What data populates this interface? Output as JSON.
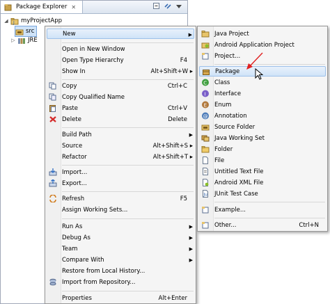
{
  "view": {
    "title": "Package Explorer",
    "close": "✕",
    "tree": [
      {
        "label": "myProjectApp"
      },
      {
        "label": "src"
      },
      {
        "label": "JRE"
      }
    ]
  },
  "context_menu": {
    "items": [
      {
        "label": "New",
        "accel": "",
        "submenu": true
      },
      {
        "label": "Open in New Window",
        "accel": ""
      },
      {
        "label": "Open Type Hierarchy",
        "accel": "F4"
      },
      {
        "label": "Show In",
        "accel": "Alt+Shift+W ▸"
      },
      {
        "label": "Copy",
        "accel": "Ctrl+C"
      },
      {
        "label": "Copy Qualified Name",
        "accel": ""
      },
      {
        "label": "Paste",
        "accel": "Ctrl+V"
      },
      {
        "label": "Delete",
        "accel": "Delete"
      },
      {
        "label": "Build Path",
        "accel": "",
        "submenu": true
      },
      {
        "label": "Source",
        "accel": "Alt+Shift+S ▸"
      },
      {
        "label": "Refactor",
        "accel": "Alt+Shift+T ▸"
      },
      {
        "label": "Import...",
        "accel": ""
      },
      {
        "label": "Export...",
        "accel": ""
      },
      {
        "label": "Refresh",
        "accel": "F5"
      },
      {
        "label": "Assign Working Sets...",
        "accel": ""
      },
      {
        "label": "Run As",
        "accel": "",
        "submenu": true
      },
      {
        "label": "Debug As",
        "accel": "",
        "submenu": true
      },
      {
        "label": "Team",
        "accel": "",
        "submenu": true
      },
      {
        "label": "Compare With",
        "accel": "",
        "submenu": true
      },
      {
        "label": "Restore from Local History...",
        "accel": ""
      },
      {
        "label": "Import from Repository...",
        "accel": ""
      },
      {
        "label": "Properties",
        "accel": "Alt+Enter"
      }
    ]
  },
  "new_submenu": {
    "items": [
      {
        "label": "Java Project",
        "accel": ""
      },
      {
        "label": "Android Application Project",
        "accel": ""
      },
      {
        "label": "Project...",
        "accel": ""
      },
      {
        "label": "Package",
        "accel": ""
      },
      {
        "label": "Class",
        "accel": ""
      },
      {
        "label": "Interface",
        "accel": ""
      },
      {
        "label": "Enum",
        "accel": ""
      },
      {
        "label": "Annotation",
        "accel": ""
      },
      {
        "label": "Source Folder",
        "accel": ""
      },
      {
        "label": "Java Working Set",
        "accel": ""
      },
      {
        "label": "Folder",
        "accel": ""
      },
      {
        "label": "File",
        "accel": ""
      },
      {
        "label": "Untitled Text File",
        "accel": ""
      },
      {
        "label": "Android XML File",
        "accel": ""
      },
      {
        "label": "JUnit Test Case",
        "accel": ""
      },
      {
        "label": "Example...",
        "accel": ""
      },
      {
        "label": "Other...",
        "accel": "Ctrl+N"
      }
    ]
  },
  "colors": {
    "highlight": "#cfe3f8",
    "annotation_arrow": "#e02020"
  }
}
